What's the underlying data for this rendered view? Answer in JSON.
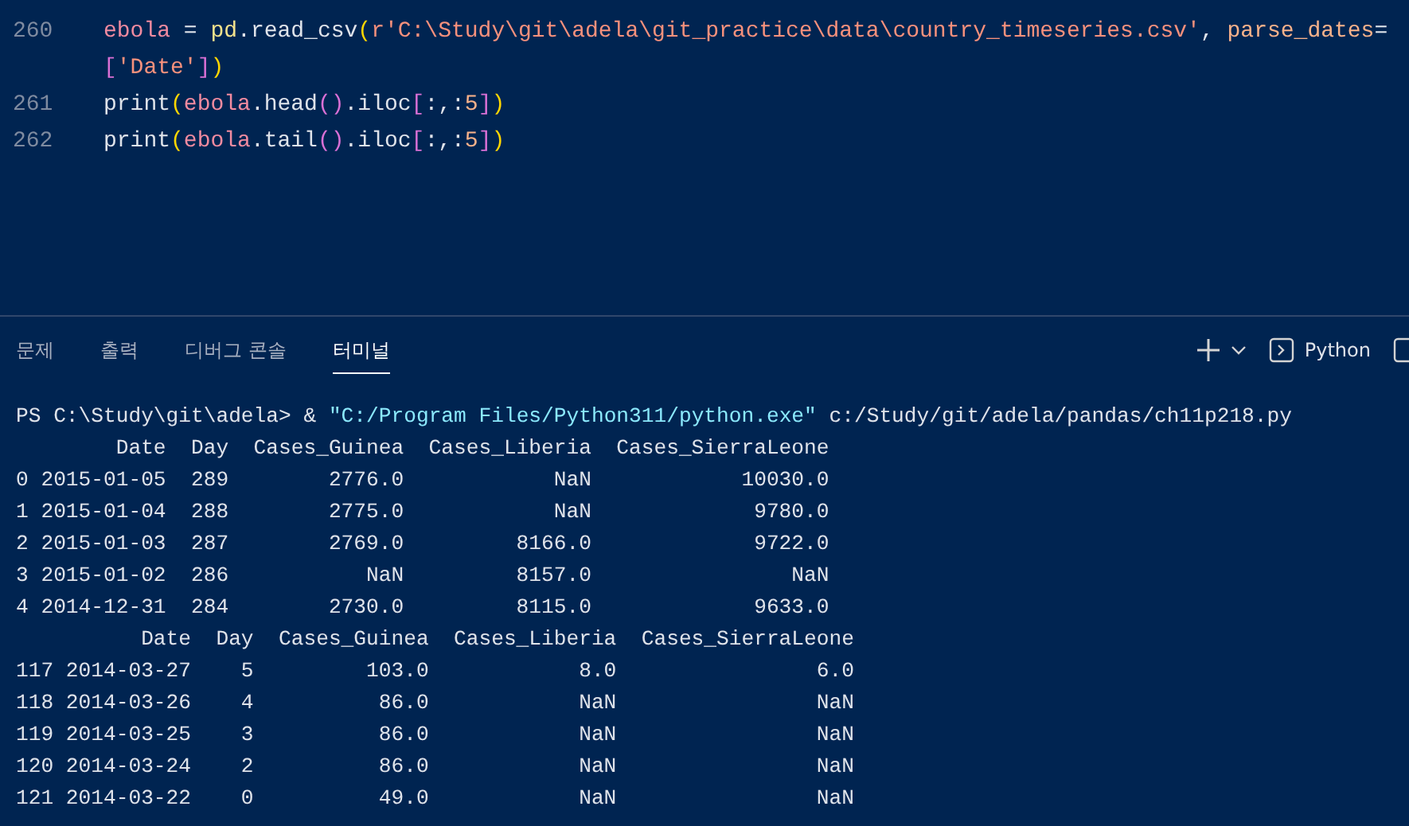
{
  "editor": {
    "lines": [
      {
        "number": "260",
        "tokens": [
          {
            "kind": "variable",
            "text": "ebola"
          },
          {
            "kind": "plain",
            "text": " = "
          },
          {
            "kind": "module",
            "text": "pd"
          },
          {
            "kind": "plain",
            "text": ".read_csv"
          },
          {
            "kind": "bracket1",
            "text": "("
          },
          {
            "kind": "string",
            "text": "r'C:\\Study\\git\\adela\\git_practice\\data\\country_timeseries.csv'"
          },
          {
            "kind": "plain",
            "text": ", "
          },
          {
            "kind": "param",
            "text": "parse_dates"
          },
          {
            "kind": "plain",
            "text": "="
          }
        ]
      },
      {
        "tokens": [
          {
            "kind": "bracket2",
            "text": "["
          },
          {
            "kind": "string",
            "text": "'Date'"
          },
          {
            "kind": "bracket2",
            "text": "]"
          },
          {
            "kind": "bracket1",
            "text": ")"
          }
        ]
      },
      {
        "number": "261",
        "tokens": [
          {
            "kind": "function",
            "text": "print"
          },
          {
            "kind": "bracket1",
            "text": "("
          },
          {
            "kind": "variable",
            "text": "ebola"
          },
          {
            "kind": "plain",
            "text": ".head"
          },
          {
            "kind": "bracket2",
            "text": "()"
          },
          {
            "kind": "plain",
            "text": ".iloc"
          },
          {
            "kind": "bracket2",
            "text": "["
          },
          {
            "kind": "plain",
            "text": ":,:"
          },
          {
            "kind": "number",
            "text": "5"
          },
          {
            "kind": "bracket2",
            "text": "]"
          },
          {
            "kind": "bracket1",
            "text": ")"
          }
        ]
      },
      {
        "number": "262",
        "tokens": [
          {
            "kind": "function",
            "text": "print"
          },
          {
            "kind": "bracket1",
            "text": "("
          },
          {
            "kind": "variable",
            "text": "ebola"
          },
          {
            "kind": "plain",
            "text": ".tail"
          },
          {
            "kind": "bracket2",
            "text": "()"
          },
          {
            "kind": "plain",
            "text": ".iloc"
          },
          {
            "kind": "bracket2",
            "text": "["
          },
          {
            "kind": "plain",
            "text": ":,:"
          },
          {
            "kind": "number",
            "text": "5"
          },
          {
            "kind": "bracket2",
            "text": "]"
          },
          {
            "kind": "bracket1",
            "text": ")"
          }
        ]
      }
    ]
  },
  "panel": {
    "tabs": [
      {
        "label": "문제",
        "selected": false
      },
      {
        "label": "출력",
        "selected": false
      },
      {
        "label": "디버그 콘솔",
        "selected": false
      },
      {
        "label": "터미널",
        "selected": true
      }
    ],
    "toolbar": {
      "terminal_label": "Python"
    }
  },
  "terminal": {
    "lines": [
      {
        "tokens": [
          {
            "kind": "plain",
            "text": "PS C:\\Study\\git\\adela> & "
          },
          {
            "kind": "string",
            "text": "\"C:/Program Files/Python311/python.exe\""
          },
          {
            "kind": "plain",
            "text": " c:/Study/git/adela/pandas/ch11p218.py"
          }
        ]
      },
      {
        "tokens": [
          {
            "kind": "plain",
            "text": "        Date  Day  Cases_Guinea  Cases_Liberia  Cases_SierraLeone"
          }
        ]
      },
      {
        "tokens": [
          {
            "kind": "plain",
            "text": "0 2015-01-05  289        2776.0            NaN            10030.0"
          }
        ]
      },
      {
        "tokens": [
          {
            "kind": "plain",
            "text": "1 2015-01-04  288        2775.0            NaN             9780.0"
          }
        ]
      },
      {
        "tokens": [
          {
            "kind": "plain",
            "text": "2 2015-01-03  287        2769.0         8166.0             9722.0"
          }
        ]
      },
      {
        "tokens": [
          {
            "kind": "plain",
            "text": "3 2015-01-02  286           NaN         8157.0                NaN"
          }
        ]
      },
      {
        "tokens": [
          {
            "kind": "plain",
            "text": "4 2014-12-31  284        2730.0         8115.0             9633.0"
          }
        ]
      },
      {
        "tokens": [
          {
            "kind": "plain",
            "text": "          Date  Day  Cases_Guinea  Cases_Liberia  Cases_SierraLeone"
          }
        ]
      },
      {
        "tokens": [
          {
            "kind": "plain",
            "text": "117 2014-03-27    5         103.0            8.0                6.0"
          }
        ]
      },
      {
        "tokens": [
          {
            "kind": "plain",
            "text": "118 2014-03-26    4          86.0            NaN                NaN"
          }
        ]
      },
      {
        "tokens": [
          {
            "kind": "plain",
            "text": "119 2014-03-25    3          86.0            NaN                NaN"
          }
        ]
      },
      {
        "tokens": [
          {
            "kind": "plain",
            "text": "120 2014-03-24    2          86.0            NaN                NaN"
          }
        ]
      },
      {
        "tokens": [
          {
            "kind": "plain",
            "text": "121 2014-03-22    0          49.0            NaN                NaN"
          }
        ]
      }
    ]
  }
}
